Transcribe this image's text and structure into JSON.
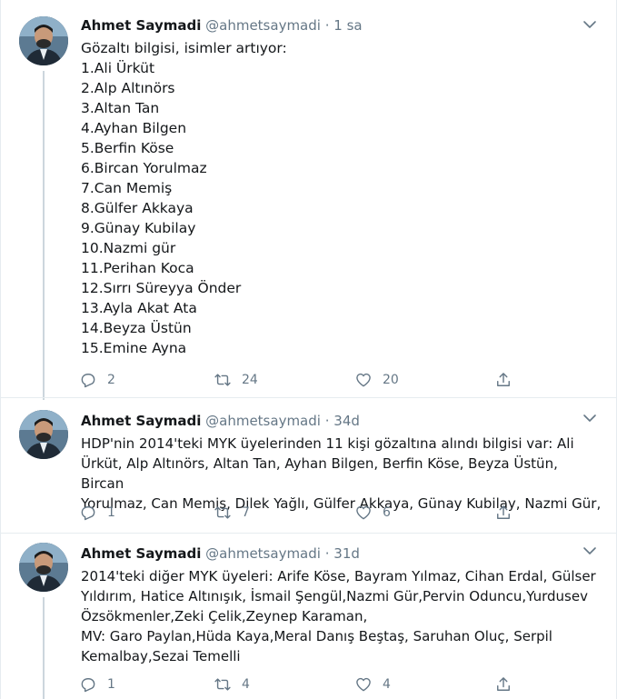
{
  "tweets": [
    {
      "author": "Ahmet Saymadi",
      "handle": "@ahmetsaymadi",
      "dot": "·",
      "time": "1 sa",
      "lines": [
        "Gözaltı bilgisi, isimler artıyor:",
        "1.Ali Ürküt",
        "2.Alp Altınörs",
        "3.Altan Tan",
        "4.Ayhan Bilgen",
        "5.Berfin Köse",
        "6.Bircan Yorulmaz",
        "7.Can Memiş",
        "8.Gülfer Akkaya",
        "9.Günay Kubilay",
        "10.Nazmi gür",
        "11.Perihan Koca",
        "12.Sırrı Süreyya Önder",
        "13.Ayla Akat Ata",
        "14.Beyza Üstün",
        "15.Emine Ayna"
      ],
      "replies": "2",
      "retweets": "24",
      "likes": "20"
    },
    {
      "author": "Ahmet Saymadi",
      "handle": "@ahmetsaymadi",
      "dot": "·",
      "time": "34d",
      "lines": [
        "HDP'nin 2014'teki MYK üyelerinden 11 kişi gözaltına alındı bilgisi var: Ali",
        "Ürküt, Alp Altınörs, Altan Tan, Ayhan Bilgen, Berfin Köse, Beyza Üstün, Bircan",
        "Yorulmaz, Can Memiş, Dilek Yağlı, Gülfer Akkaya,  Günay Kubilay,  Nazmi Gür,"
      ],
      "replies": "1",
      "retweets": "7",
      "likes": "6"
    },
    {
      "author": "Ahmet Saymadi",
      "handle": "@ahmetsaymadi",
      "dot": "·",
      "time": "31d",
      "lines": [
        "2014'teki diğer MYK üyeleri: Arife Köse, Bayram Yılmaz, Cihan Erdal, Gülser",
        "Yıldırım, Hatice Altınışık, İsmail Şengül,Nazmi Gür,Pervin Oduncu,Yurdusev",
        "Özsökmenler,Zeki Çelik,Zeynep Karaman,",
        "MV: Garo Paylan,Hüda Kaya,Meral Danış Beştaş, Saruhan Oluç, Serpil",
        "Kemalbay,Sezai Temelli"
      ],
      "replies": "1",
      "retweets": "4",
      "likes": "4"
    }
  ],
  "icons": {
    "reply": "reply-icon",
    "retweet": "retweet-icon",
    "like": "heart-icon",
    "share": "share-icon",
    "more": "chevron-down-icon"
  },
  "colors": {
    "icon": "#657786",
    "name": "#14171a",
    "separator": "#e6ecf0",
    "thread_line": "#ccd6dd"
  }
}
